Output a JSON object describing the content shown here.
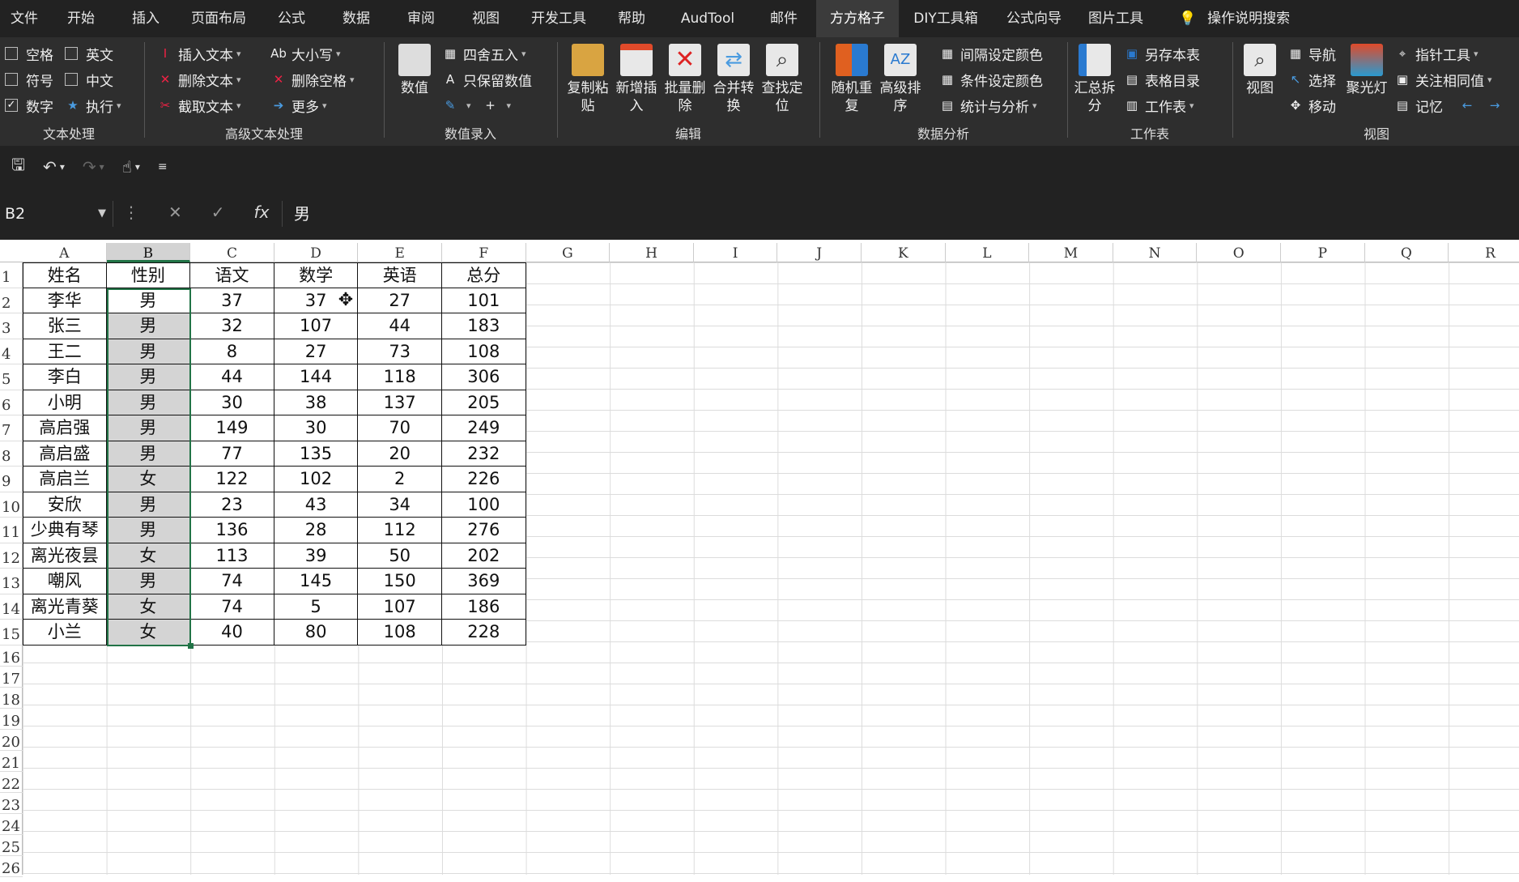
{
  "menu": {
    "tabs": [
      "文件",
      "开始",
      "插入",
      "页面布局",
      "公式",
      "数据",
      "审阅",
      "视图",
      "开发工具",
      "帮助",
      "AudTool",
      "邮件",
      "方方格子",
      "DIY工具箱",
      "公式向导",
      "图片工具"
    ],
    "active": "方方格子",
    "search": "操作说明搜索"
  },
  "ribbon": {
    "text_proc": {
      "label": "文本处理",
      "items": [
        "空格",
        "英文",
        "符号",
        "中文",
        "数字",
        "执行"
      ]
    },
    "adv_text": {
      "label": "高级文本处理",
      "items": [
        "插入文本",
        "删除文本",
        "截取文本",
        "大小写",
        "删除空格",
        "更多"
      ]
    },
    "num_input": {
      "label": "数值录入",
      "big": "数值",
      "items": [
        "四舍五入",
        "只保留数值"
      ]
    },
    "edit": {
      "label": "编辑",
      "big": [
        "复制粘贴",
        "新增插入",
        "批量删除",
        "合并转换",
        "查找定位"
      ]
    },
    "analysis": {
      "label": "数据分析",
      "big": [
        "随机重复",
        "高级排序"
      ],
      "items": [
        "间隔设定颜色",
        "条件设定颜色",
        "统计与分析"
      ]
    },
    "sheet": {
      "label": "工作表",
      "big": "汇总拆分",
      "items": [
        "另存本表",
        "表格目录",
        "工作表"
      ]
    },
    "view": {
      "label": "视图",
      "big": [
        "视图",
        "聚光灯"
      ],
      "items": [
        "导航",
        "选择",
        "移动",
        "指针工具",
        "关注相同值",
        "记忆"
      ]
    }
  },
  "namebox": "B2",
  "formula": "男",
  "columns": [
    "A",
    "B",
    "C",
    "D",
    "E",
    "F",
    "G",
    "H",
    "I",
    "J",
    "K",
    "L",
    "M",
    "N",
    "O",
    "P",
    "Q",
    "R"
  ],
  "rows": [
    "1",
    "2",
    "3",
    "4",
    "5",
    "6",
    "7",
    "8",
    "9",
    "10",
    "11",
    "12",
    "13",
    "14",
    "15",
    "16",
    "17",
    "18",
    "19",
    "20",
    "21",
    "22",
    "23",
    "24",
    "25",
    "26"
  ],
  "table": {
    "headers": [
      "姓名",
      "性别",
      "语文",
      "数学",
      "英语",
      "总分"
    ],
    "data": [
      [
        "李华",
        "男",
        "37",
        "37",
        "27",
        "101"
      ],
      [
        "张三",
        "男",
        "32",
        "107",
        "44",
        "183"
      ],
      [
        "王二",
        "男",
        "8",
        "27",
        "73",
        "108"
      ],
      [
        "李白",
        "男",
        "44",
        "144",
        "118",
        "306"
      ],
      [
        "小明",
        "男",
        "30",
        "38",
        "137",
        "205"
      ],
      [
        "高启强",
        "男",
        "149",
        "30",
        "70",
        "249"
      ],
      [
        "高启盛",
        "男",
        "77",
        "135",
        "20",
        "232"
      ],
      [
        "高启兰",
        "女",
        "122",
        "102",
        "2",
        "226"
      ],
      [
        "安欣",
        "男",
        "23",
        "43",
        "34",
        "100"
      ],
      [
        "少典有琴",
        "男",
        "136",
        "28",
        "112",
        "276"
      ],
      [
        "离光夜昙",
        "女",
        "113",
        "39",
        "50",
        "202"
      ],
      [
        "嘲风",
        "男",
        "74",
        "145",
        "150",
        "369"
      ],
      [
        "离光青葵",
        "女",
        "74",
        "5",
        "107",
        "186"
      ],
      [
        "小兰",
        "女",
        "40",
        "80",
        "108",
        "228"
      ]
    ]
  }
}
